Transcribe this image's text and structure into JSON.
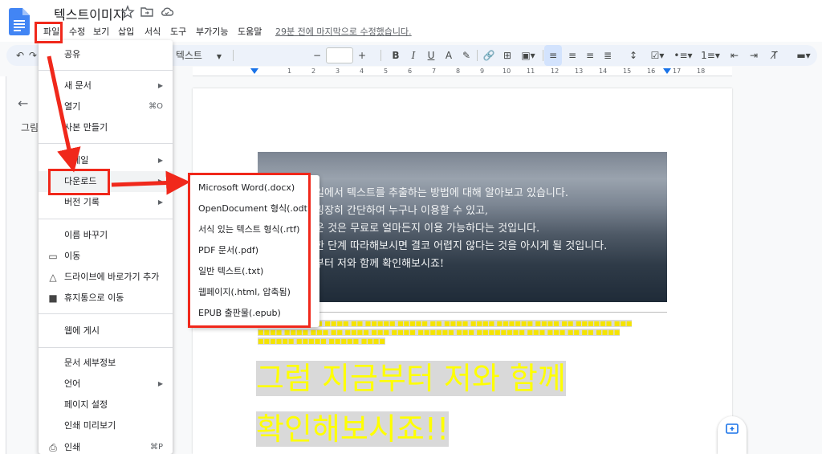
{
  "app": {
    "title": "텍스트이미지",
    "last_edit": "29분 전에 마지막으로 수정했습니다."
  },
  "menubar": {
    "items": [
      "파일",
      "수정",
      "보기",
      "삽입",
      "서식",
      "도구",
      "부가기능",
      "도움말"
    ]
  },
  "toolbar": {
    "style_select": "반 텍스트",
    "font_size": "",
    "bold": "B",
    "italic": "I",
    "underline": "U",
    "text_color": "A"
  },
  "ruler": {
    "numbers": [
      "1",
      "2",
      "3",
      "4",
      "5",
      "6",
      "7",
      "8",
      "9",
      "10",
      "11",
      "12",
      "13",
      "14",
      "15",
      "16",
      "17",
      "18"
    ]
  },
  "outline": {
    "title": "그림"
  },
  "file_menu": {
    "share": "공유",
    "new_doc": "새 문서",
    "open": "열기",
    "open_shortcut": "⌘O",
    "make_copy": "사본 만들기",
    "email": "이메일",
    "download": "다운로드",
    "version_history": "버전 기록",
    "rename": "이름 바꾸기",
    "move": "이동",
    "add_shortcut": "드라이브에 바로가기 추가",
    "trash": "휴지통으로 이동",
    "publish": "웹에 게시",
    "details": "문서 세부정보",
    "language": "언어",
    "page_setup": "페이지 설정",
    "print_preview": "인쇄 미리보기",
    "print": "인쇄",
    "print_shortcut": "⌘P"
  },
  "download_menu": {
    "items": [
      "Microsoft Word(.docx)",
      "OpenDocument 형식(.odt)",
      "서식 있는 텍스트 형식(.rtf)",
      "PDF 문서(.pdf)",
      "일반 텍스트(.txt)",
      "웹페이지(.html, 압축됨)",
      "EPUB 출판물(.epub)"
    ]
  },
  "document": {
    "image_lines": [
      "일에서 텍스트를 추출하는 방법에 대해 알아보고 있습니다.",
      "굉장히 간단하여 누구나 이용할 수 있고,",
      "운 것은 무료로 얼마든지 이용 가능하다는 것입니다.",
      "한 단계 따라해보시면 결코 어렵지 않다는 것을 아시게 될 것입니다.",
      "부터 저와 함께 확인해보시죠!"
    ],
    "big_text_line1": "그럼 지금부터 저와 함께",
    "big_text_line2": "확인해보시죠!!"
  },
  "colors": {
    "annotation_red": "#f0281b",
    "accent_blue": "#1a73e8",
    "highlight_yellow": "#ffff00"
  }
}
